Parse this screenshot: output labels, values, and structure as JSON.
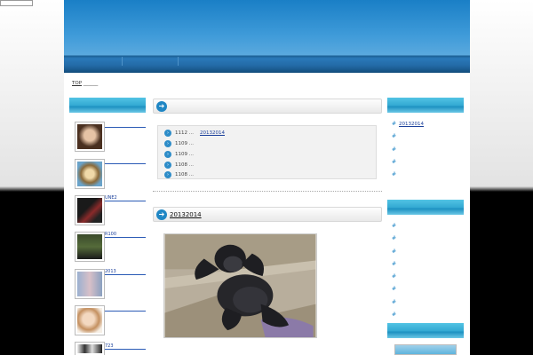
{
  "breadcrumb": {
    "top_label": "TOP"
  },
  "left_sidebar": {
    "avatars": [
      {
        "label": ""
      },
      {
        "label": ""
      },
      {
        "label": "UNE2"
      },
      {
        "label": "R100"
      },
      {
        "label": "2013"
      },
      {
        "label": ""
      },
      {
        "label": "723"
      }
    ]
  },
  "main": {
    "news_items": [
      {
        "date": "1112 ...",
        "title": "20132014"
      },
      {
        "date": "1109 ...",
        "title": ""
      },
      {
        "date": "1109 ...",
        "title": ""
      },
      {
        "date": "1108 ...",
        "title": ""
      },
      {
        "date": "1108 ...",
        "title": ""
      }
    ],
    "article_title": "20132014"
  },
  "right_sidebar": {
    "links1": [
      "20132014",
      "",
      "",
      "",
      ""
    ],
    "links2": [
      "",
      "",
      "",
      "",
      "",
      "",
      "",
      ""
    ]
  }
}
